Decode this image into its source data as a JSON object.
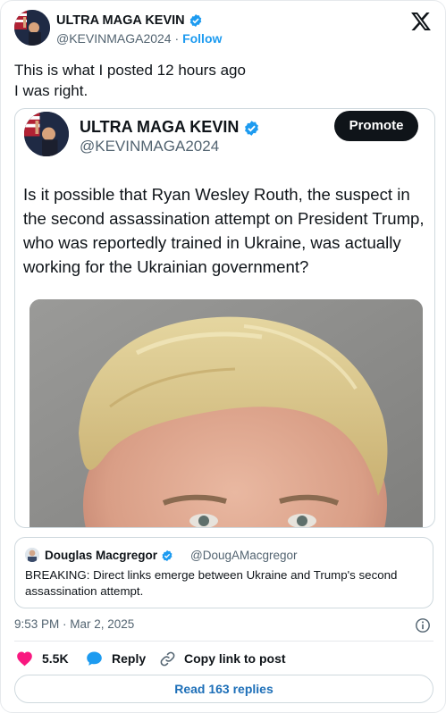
{
  "header": {
    "name": "ULTRA MAGA KEVIN",
    "handle": "@KEVINMAGA2024",
    "separator": "·",
    "follow_label": "Follow"
  },
  "post": {
    "text": "This is what I posted 12 hours ago\nI was right."
  },
  "embedded": {
    "name": "ULTRA MAGA KEVIN",
    "handle": "@KEVINMAGA2024",
    "promote_label": "Promote",
    "text": "Is it possible that Ryan Wesley Routh, the suspect in the second assassination attempt on President Trump, who was reportedly trained in Ukraine, was actually working for the Ukrainian government?"
  },
  "quote": {
    "name": "Douglas Macgregor",
    "handle": "@DougAMacgregor",
    "text": "BREAKING: Direct links emerge between Ukraine and Trump's second assassination attempt."
  },
  "meta": {
    "timestamp": "9:53 PM · Mar 2, 2025"
  },
  "actions": {
    "likes": "5.5K",
    "reply_label": "Reply",
    "copy_label": "Copy link to post",
    "read_replies_label": "Read 163 replies"
  },
  "colors": {
    "accent": "#1d9bf0",
    "like": "#f91880",
    "text": "#0f1419",
    "muted": "#536471"
  },
  "icons": [
    "x-logo-icon",
    "verified-badge-icon",
    "info-icon",
    "heart-icon",
    "reply-bubble-icon",
    "link-icon"
  ]
}
